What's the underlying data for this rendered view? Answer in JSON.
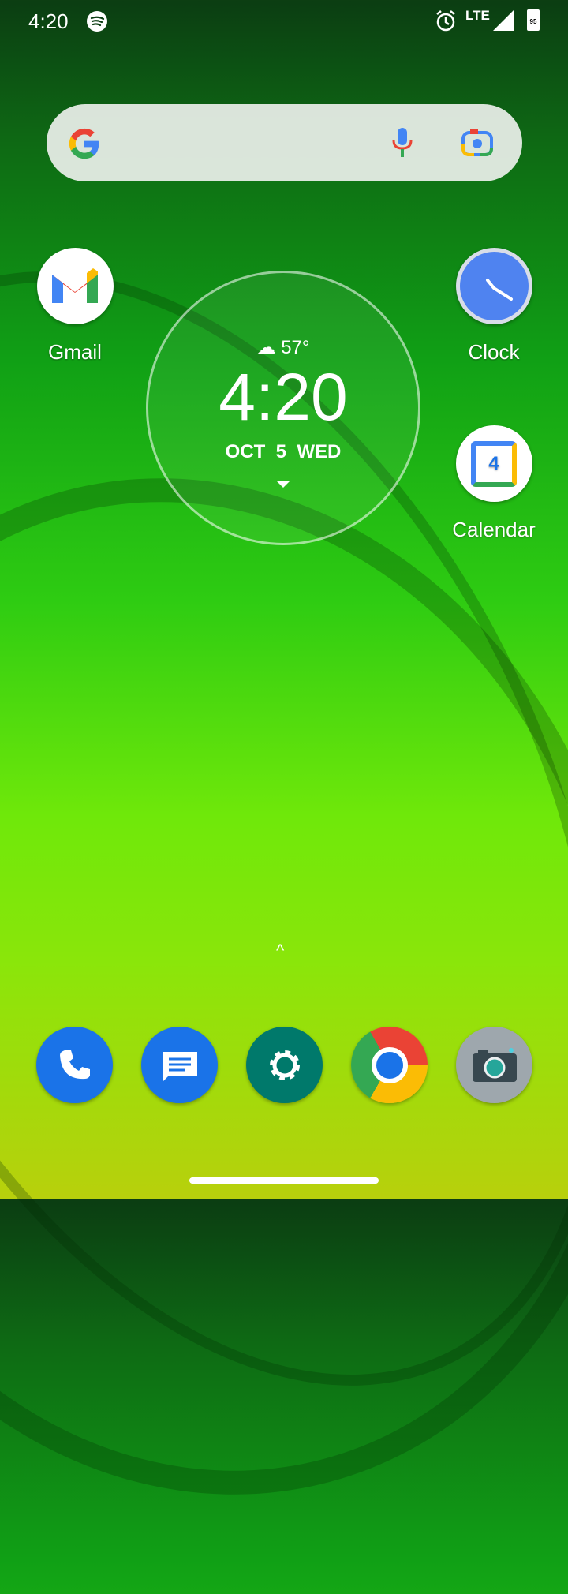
{
  "status_bar": {
    "time": "4:20",
    "network": "LTE",
    "battery": "95"
  },
  "widget": {
    "temperature": "57°",
    "time": "4:20",
    "date": "OCT  5  WED"
  },
  "apps": [
    {
      "label": "Gmail"
    },
    {
      "label": "Clock"
    },
    {
      "label": "Calendar"
    }
  ],
  "calendar_day": "4",
  "dock": [
    "Phone",
    "Messages",
    "Settings",
    "Chrome",
    "Camera"
  ]
}
